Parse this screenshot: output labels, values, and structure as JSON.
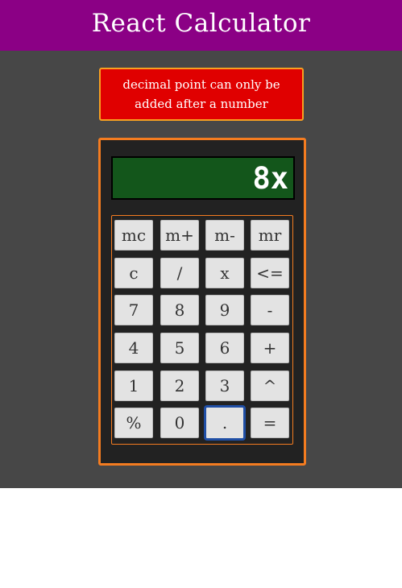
{
  "header": {
    "title": "React Calculator",
    "background_color": "#8b0085"
  },
  "error": {
    "message": "decimal point can only be added after a number",
    "background_color": "#e00000",
    "border_color": "#f7a021"
  },
  "calculator": {
    "display_value": "8x",
    "display_color": "#13561b",
    "accent_color": "#f47c20",
    "focused_key": ".",
    "keys": [
      [
        "mc",
        "m+",
        "m-",
        "mr"
      ],
      [
        "c",
        "/",
        "x",
        "<="
      ],
      [
        "7",
        "8",
        "9",
        "-"
      ],
      [
        "4",
        "5",
        "6",
        "+"
      ],
      [
        "1",
        "2",
        "3",
        "^"
      ],
      [
        "%",
        "0",
        ".",
        "="
      ]
    ]
  }
}
